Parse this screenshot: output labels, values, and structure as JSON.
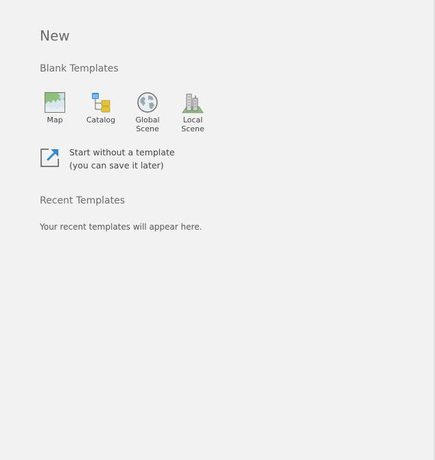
{
  "page": {
    "title": "New"
  },
  "blank_templates": {
    "heading": "Blank Templates",
    "items": [
      {
        "label_line1": "Map",
        "label_line2": "",
        "icon": "map-icon"
      },
      {
        "label_line1": "Catalog",
        "label_line2": "",
        "icon": "catalog-icon"
      },
      {
        "label_line1": "Global",
        "label_line2": "Scene",
        "icon": "globe-icon"
      },
      {
        "label_line1": "Local",
        "label_line2": "Scene",
        "icon": "local-scene-icon"
      }
    ],
    "start_without": {
      "line1": "Start without a template",
      "line2": "(you can save it later)",
      "icon": "open-external-arrow-icon"
    }
  },
  "recent_templates": {
    "heading": "Recent Templates",
    "empty_message": "Your recent templates will appear here."
  },
  "colors": {
    "background": "#f2f2f2",
    "heading": "#6b6b6b",
    "accent_blue": "#2e8bd0"
  }
}
